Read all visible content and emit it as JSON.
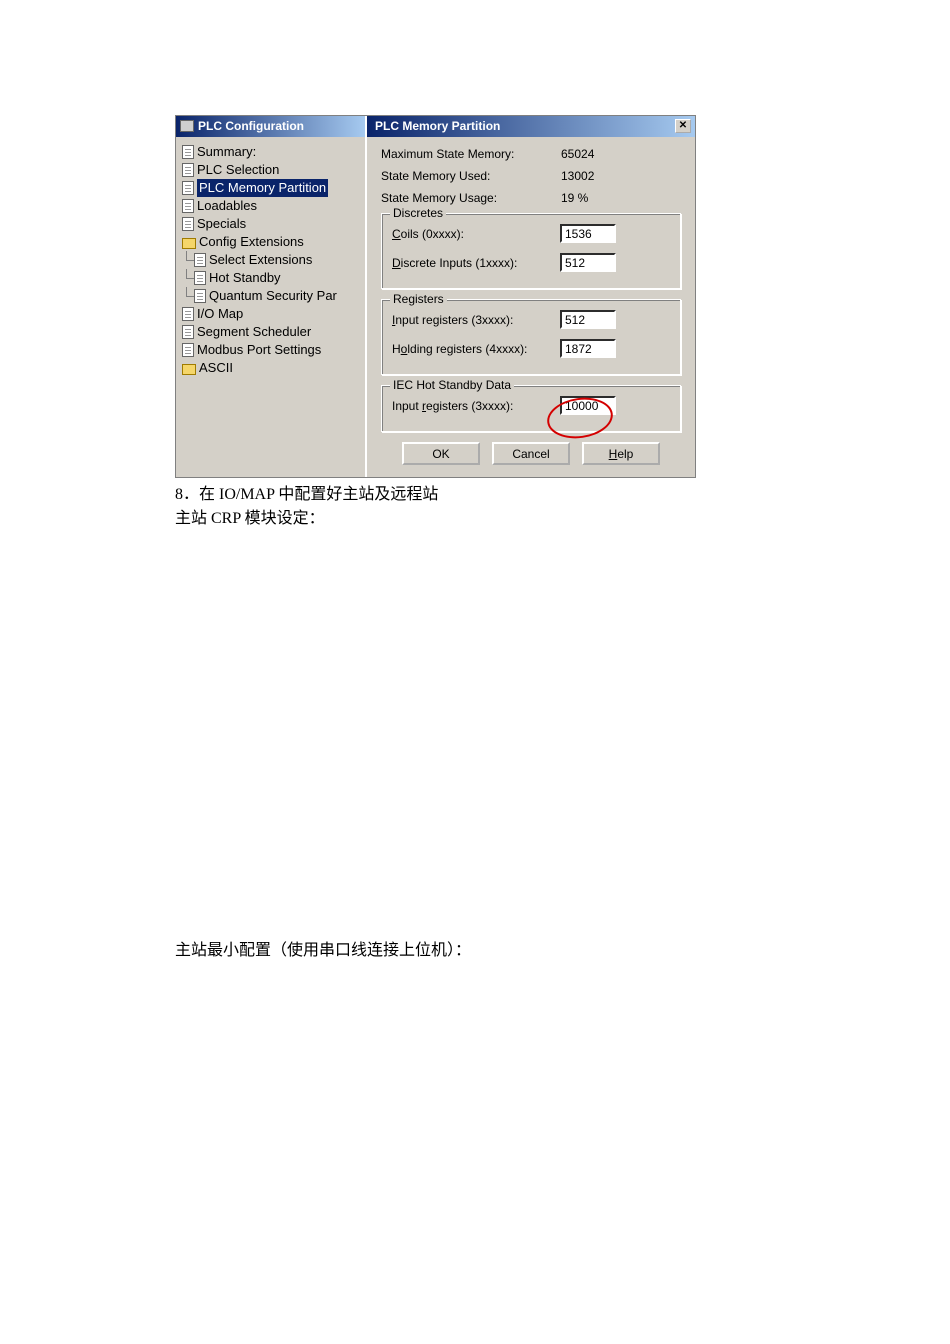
{
  "tree": {
    "title": "PLC Configuration",
    "items": [
      {
        "label": "Summary:"
      },
      {
        "label": "PLC Selection"
      },
      {
        "label": "PLC Memory Partition",
        "selected": true
      },
      {
        "label": "Loadables"
      },
      {
        "label": "Specials"
      },
      {
        "label": "Config Extensions",
        "folder": true
      },
      {
        "label": "Select Extensions",
        "child": true
      },
      {
        "label": "Hot Standby",
        "child": true
      },
      {
        "label": "Quantum Security Par",
        "child": true
      },
      {
        "label": "I/O Map"
      },
      {
        "label": "Segment Scheduler"
      },
      {
        "label": "Modbus Port Settings"
      },
      {
        "label": "ASCII",
        "folder": true
      }
    ]
  },
  "dialog": {
    "title": "PLC Memory Partition",
    "close": "✕",
    "stats": {
      "max_label": "Maximum State Memory:",
      "max_value": "65024",
      "used_label": "State Memory Used:",
      "used_value": "13002",
      "usage_label": "State Memory Usage:",
      "usage_value": "19 %"
    },
    "discretes": {
      "legend": "Discretes",
      "coils_label": "Coils (0xxxx):",
      "coils_value": "1536",
      "di_label": "Discrete Inputs (1xxxx):",
      "di_value": "512"
    },
    "registers": {
      "legend": "Registers",
      "ir_label": "Input registers (3xxxx):",
      "ir_value": "512",
      "hr_label": "Holding registers (4xxxx):",
      "hr_value": "1872"
    },
    "hotstandby": {
      "legend": "IEC Hot Standby Data",
      "ir_label": "Input registers (3xxxx):",
      "ir_value": "10000"
    },
    "buttons": {
      "ok": "OK",
      "cancel": "Cancel",
      "help": "Help"
    }
  },
  "document": {
    "line1": "8．在 IO/MAP 中配置好主站及远程站",
    "line2": "主站 CRP 模块设定：",
    "line3": "主站最小配置（使用串口线连接上位机）："
  }
}
